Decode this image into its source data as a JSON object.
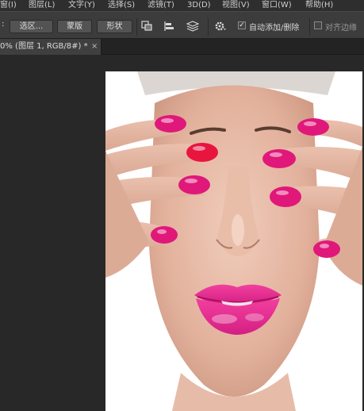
{
  "menu": {
    "items": [
      "窗(I)",
      "图层(L)",
      "文字(Y)",
      "选择(S)",
      "滤镜(T)",
      "3D(D)",
      "视图(V)",
      "窗口(W)",
      "帮助(H)"
    ]
  },
  "options": {
    "select_button": "选区...",
    "mask_button": "蒙版",
    "shape_button": "形状",
    "auto_add_delete_label": "自动添加/删除",
    "auto_add_delete_checked": true,
    "align_edges_label": "对齐边缘",
    "align_edges_checked": false
  },
  "document": {
    "tab_title": "0% (图层 1, RGB/8#) *",
    "close_symbol": "×"
  },
  "colors": {
    "nail": "#e0187a",
    "lip": "#f13a9c",
    "skin": "#eac4b2"
  },
  "icons": [
    "gear-icon",
    "path-combine-icon",
    "path-align-icon",
    "path-arrange-icon"
  ]
}
